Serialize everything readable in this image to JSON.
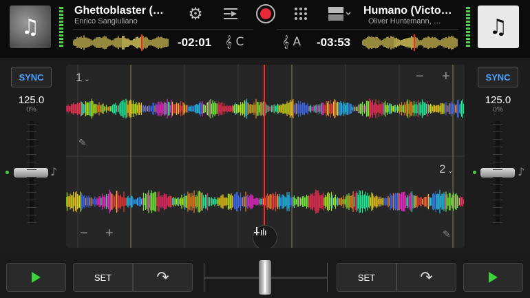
{
  "deck_a": {
    "title": "Ghettoblaster (…",
    "artist": "Enrico Sangiuliano",
    "time_remaining": "-02:01",
    "key": "C",
    "bpm": "125.0",
    "pitch_pct": "0%",
    "deck_number": "1",
    "sync_label": "SYNC",
    "set_label": "SET",
    "zoom_minus": "−",
    "zoom_plus": "+"
  },
  "deck_b": {
    "title": "Humano (Victo…",
    "artist": "Oliver Huntemann, …",
    "time_remaining": "-03:53",
    "key": "A",
    "bpm": "125.0",
    "pitch_pct": "0%",
    "deck_number": "2",
    "sync_label": "SYNC",
    "set_label": "SET",
    "zoom_minus": "−",
    "zoom_plus": "+"
  },
  "icons": {
    "music_note": "♫",
    "music_note_single": "♪",
    "gear": "⚙",
    "automix": "≡▶",
    "grid": "⠿",
    "layout": "▀▾",
    "key_clef": "𝄞",
    "pencil": "✎",
    "eq": "⫩",
    "loop": "↷"
  },
  "colors": {
    "accent_sync": "#4aa3ff",
    "record": "#e8293a",
    "play": "#3ed03e",
    "playhead": "#ff2a1a"
  }
}
